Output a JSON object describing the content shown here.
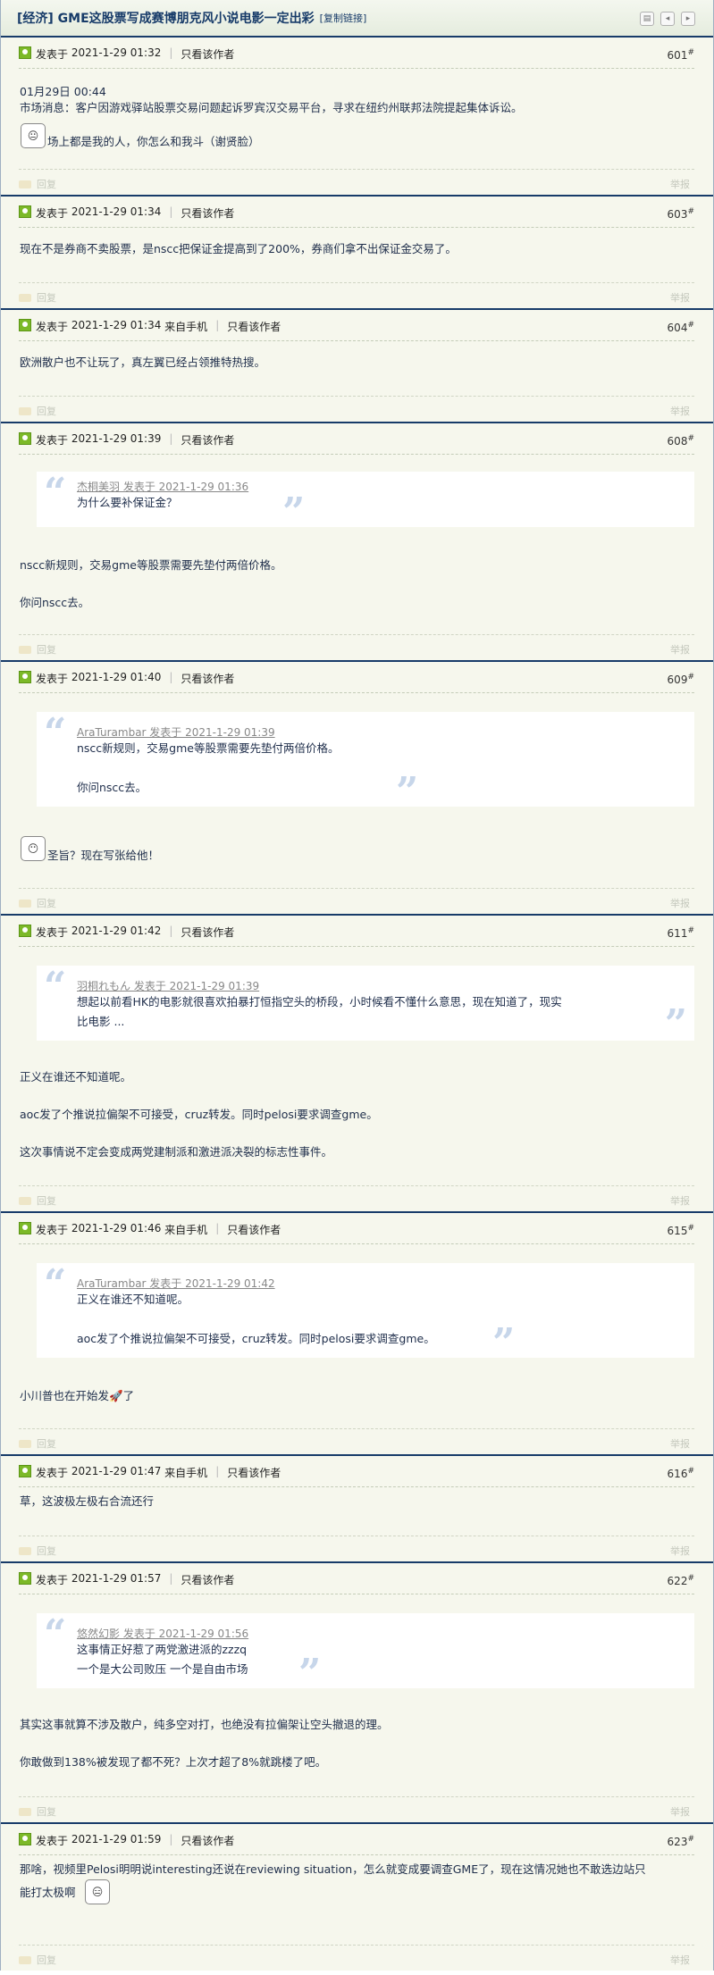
{
  "thread": {
    "title": "[经济] GME这股票写成赛博朋克风小说电影一定出彩",
    "copy_link": "[复制链接]"
  },
  "labels": {
    "posted_at": "发表于",
    "only_author": "只看该作者",
    "reply": "回复",
    "report": "举报",
    "from_mobile": "来自手机"
  },
  "posts": [
    {
      "time": "2021-1-29 01:32",
      "mobile": false,
      "floor": "601",
      "lines": [
        "01月29日 00:44",
        "市场消息：客户因游戏驿站股票交易问题起诉罗宾汉交易平台，寻求在纽约州联邦法院提起集体诉讼。",
        "场上都是我的人，你怎么和我斗（谢贤脸）"
      ]
    },
    {
      "time": "2021-1-29 01:34",
      "mobile": false,
      "floor": "603",
      "lines": [
        "现在不是券商不卖股票，是nscc把保证金提高到了200%，券商们拿不出保证金交易了。"
      ]
    },
    {
      "time": "2021-1-29 01:34",
      "mobile": true,
      "floor": "604",
      "lines": [
        "欧洲散户也不让玩了，真左翼已经占领推特热搜。"
      ]
    },
    {
      "time": "2021-1-29 01:39",
      "mobile": false,
      "floor": "608",
      "quote": {
        "head": "杰桐美羽 发表于 2021-1-29 01:36",
        "lines": [
          "为什么要补保证金？"
        ]
      },
      "lines": [
        "nscc新规则，交易gme等股票需要先垫付两倍价格。",
        "你问nscc去。"
      ]
    },
    {
      "time": "2021-1-29 01:40",
      "mobile": false,
      "floor": "609",
      "quote": {
        "head": "AraTurambar 发表于 2021-1-29 01:39",
        "lines": [
          "nscc新规则，交易gme等股票需要先垫付两倍价格。",
          "你问nscc去。"
        ]
      },
      "lines": [
        "圣旨？现在写张给他！"
      ]
    },
    {
      "time": "2021-1-29 01:42",
      "mobile": false,
      "floor": "611",
      "quote": {
        "head": "羽桐れもん 发表于 2021-1-29 01:39",
        "lines": [
          "想起以前看HK的电影就很喜欢拍暴打恒指空头的桥段，小时候看不懂什么意思，现在知道了，现实",
          "比电影 ..."
        ]
      },
      "lines": [
        "正义在谁还不知道呢。",
        "aoc发了个推说拉偏架不可接受，cruz转发。同时pelosi要求调查gme。",
        "这次事情说不定会变成两党建制派和激进派决裂的标志性事件。"
      ]
    },
    {
      "time": "2021-1-29 01:46",
      "mobile": true,
      "floor": "615",
      "quote": {
        "head": "AraTurambar 发表于 2021-1-29 01:42",
        "lines": [
          "正义在谁还不知道呢。",
          "aoc发了个推说拉偏架不可接受，cruz转发。同时pelosi要求调查gme。"
        ]
      },
      "lines": [
        "小川普也在开始发",
        "了"
      ]
    },
    {
      "time": "2021-1-29 01:47",
      "mobile": true,
      "floor": "616",
      "lines": [
        "草，这波极左极右合流还行"
      ]
    },
    {
      "time": "2021-1-29 01:57",
      "mobile": false,
      "floor": "622",
      "quote": {
        "head": "悠然幻影 发表于 2021-1-29 01:56",
        "lines": [
          "这事情正好惹了两党激进派的zzzq",
          "一个是大公司败压 一个是自由市场"
        ]
      },
      "lines": [
        "其实这事就算不涉及散户，纯多空对打，也绝没有拉偏架让空头撤退的理。",
        "你敢做到138%被发现了都不死？上次才超了8%就跳楼了吧。"
      ]
    },
    {
      "time": "2021-1-29 01:59",
      "mobile": false,
      "floor": "623",
      "lines": [
        "那啥，视频里Pelosi明明说interesting还说在reviewing situation，怎么就变成要调查GME了，现在这情况她也不敢选边站只",
        "能打太极啊"
      ]
    }
  ]
}
